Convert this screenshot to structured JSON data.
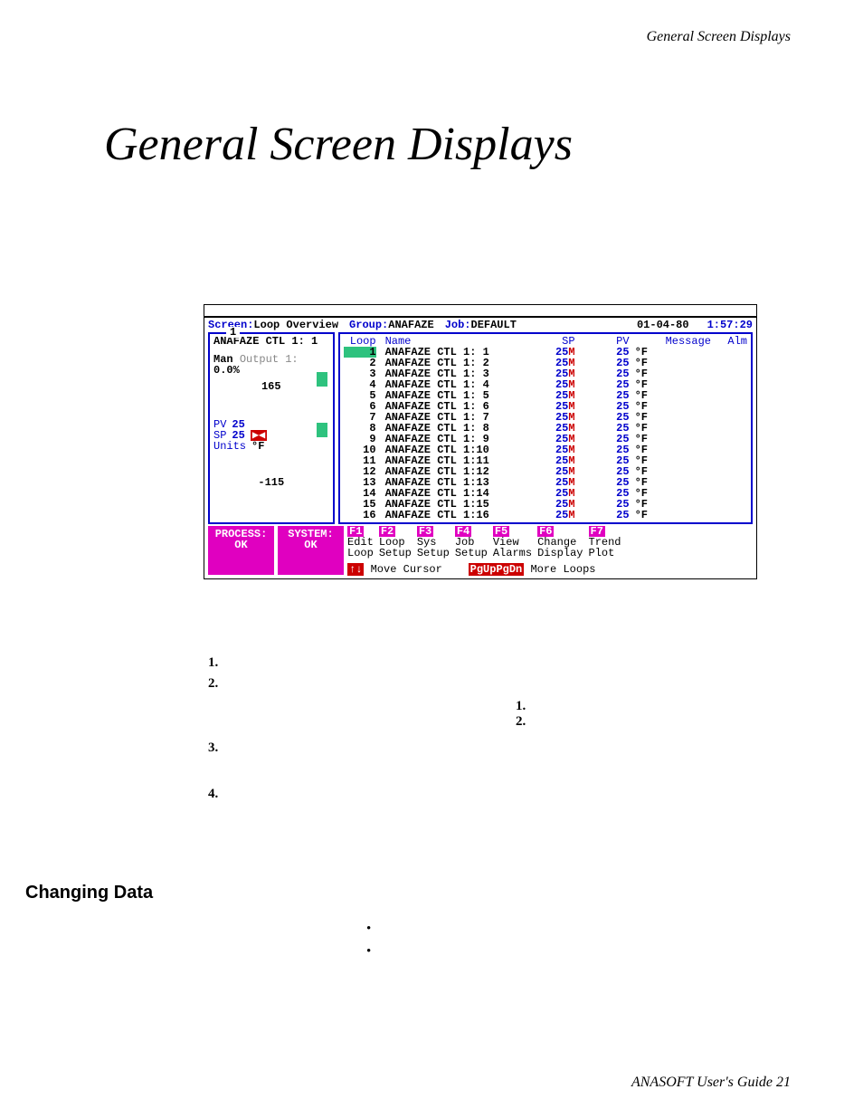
{
  "header": "General Screen Displays",
  "title": "General Screen Displays",
  "footer": "ANASOFT User's Guide 21",
  "section_heading": "Changing Data",
  "list": [
    "1.",
    "2.",
    "3.",
    "4."
  ],
  "sublist": [
    "1.",
    "2."
  ],
  "screen": {
    "labels": {
      "screen": "Screen:",
      "group": "Group:",
      "job": "Job:"
    },
    "values": {
      "screen": "Loop Overview",
      "group": "ANAFAZE",
      "job": "DEFAULT",
      "date": "01-04-80",
      "time": "1:57:29"
    }
  },
  "single": {
    "tab": "1",
    "name": "ANAFAZE CTL 1: 1",
    "mode": "Man",
    "output_label": "Output 1:",
    "output_value": "0.0%",
    "hi": "165",
    "lo": "-115",
    "pv_label": "PV",
    "pv": "25",
    "sp_label": "SP",
    "sp": "25",
    "units_label": "Units",
    "units": "°F"
  },
  "overview": {
    "headers": {
      "loop": "Loop",
      "name": "Name",
      "sp": "SP",
      "pv": "PV",
      "msg": "Message",
      "alm": "Alm"
    },
    "rows": [
      {
        "n": "1",
        "name": "ANAFAZE CTL 1: 1",
        "sp": "25",
        "pv": "25",
        "u": "°F",
        "sel": true
      },
      {
        "n": "2",
        "name": "ANAFAZE CTL 1: 2",
        "sp": "25",
        "pv": "25",
        "u": "°F"
      },
      {
        "n": "3",
        "name": "ANAFAZE CTL 1: 3",
        "sp": "25",
        "pv": "25",
        "u": "°F"
      },
      {
        "n": "4",
        "name": "ANAFAZE CTL 1: 4",
        "sp": "25",
        "pv": "25",
        "u": "°F"
      },
      {
        "n": "5",
        "name": "ANAFAZE CTL 1: 5",
        "sp": "25",
        "pv": "25",
        "u": "°F"
      },
      {
        "n": "6",
        "name": "ANAFAZE CTL 1: 6",
        "sp": "25",
        "pv": "25",
        "u": "°F"
      },
      {
        "n": "7",
        "name": "ANAFAZE CTL 1: 7",
        "sp": "25",
        "pv": "25",
        "u": "°F"
      },
      {
        "n": "8",
        "name": "ANAFAZE CTL 1: 8",
        "sp": "25",
        "pv": "25",
        "u": "°F"
      },
      {
        "n": "9",
        "name": "ANAFAZE CTL 1: 9",
        "sp": "25",
        "pv": "25",
        "u": "°F"
      },
      {
        "n": "10",
        "name": "ANAFAZE CTL 1:10",
        "sp": "25",
        "pv": "25",
        "u": "°F"
      },
      {
        "n": "11",
        "name": "ANAFAZE CTL 1:11",
        "sp": "25",
        "pv": "25",
        "u": "°F"
      },
      {
        "n": "12",
        "name": "ANAFAZE CTL 1:12",
        "sp": "25",
        "pv": "25",
        "u": "°F"
      },
      {
        "n": "13",
        "name": "ANAFAZE CTL 1:13",
        "sp": "25",
        "pv": "25",
        "u": "°F"
      },
      {
        "n": "14",
        "name": "ANAFAZE CTL 1:14",
        "sp": "25",
        "pv": "25",
        "u": "°F"
      },
      {
        "n": "15",
        "name": "ANAFAZE CTL 1:15",
        "sp": "25",
        "pv": "25",
        "u": "°F"
      },
      {
        "n": "16",
        "name": "ANAFAZE CTL 1:16",
        "sp": "25",
        "pv": "25",
        "u": "°F"
      }
    ]
  },
  "status": {
    "process": {
      "label": "PROCESS:",
      "value": "OK"
    },
    "system": {
      "label": "SYSTEM:",
      "value": "OK"
    }
  },
  "fkeys": [
    {
      "key": "F1",
      "l1": "Edit",
      "l2": "Loop"
    },
    {
      "key": "F2",
      "l1": "Loop",
      "l2": "Setup"
    },
    {
      "key": "F3",
      "l1": "Sys",
      "l2": "Setup"
    },
    {
      "key": "F4",
      "l1": "Job",
      "l2": "Setup"
    },
    {
      "key": "F5",
      "l1": "View",
      "l2": "Alarms"
    },
    {
      "key": "F6",
      "l1": "Change",
      "l2": "Display"
    },
    {
      "key": "F7",
      "l1": "Trend",
      "l2": "Plot"
    }
  ],
  "hints": {
    "arrows": {
      "key": "↑↓",
      "text": "Move Cursor"
    },
    "page": {
      "key": "PgUpPgDn",
      "text": "More Loops"
    }
  }
}
